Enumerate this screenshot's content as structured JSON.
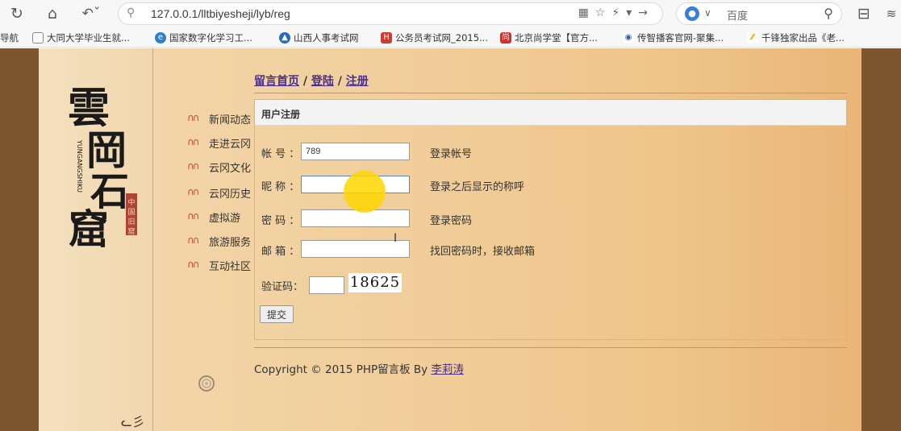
{
  "browser": {
    "url": "127.0.0.1/lltbiyesheji/lyb/reg",
    "search_engine": "百度"
  },
  "bookmarks": [
    {
      "label": "导航",
      "icon": "none"
    },
    {
      "label": "大同大学毕业生就...",
      "icon": "page-icon"
    },
    {
      "label": "国家数字化学习工...",
      "icon": "e-icon"
    },
    {
      "label": "山西人事考试网",
      "icon": "blue-logo-icon"
    },
    {
      "label": "公务员考试网_2015...",
      "icon": "red-logo-icon"
    },
    {
      "label": "北京尚学堂【官方...",
      "icon": "shang-icon"
    },
    {
      "label": "传智播客官网-聚集...",
      "icon": "blue-swirl-icon"
    },
    {
      "label": "千锋独家出品《老...",
      "icon": "yellow-bars-icon"
    }
  ],
  "site": {
    "logo_text": "雲岡石窟",
    "logo_latin": "YUNGANGSHIKU",
    "logo_seal": "中国旧窟"
  },
  "nav": [
    "新闻动态",
    "走进云冈",
    "云冈文化",
    "云冈历史",
    "虚拟游",
    "旅游服务",
    "互动社区"
  ],
  "breadcrumb": {
    "home": "留言首页",
    "sep1": " / ",
    "login": "登陆",
    "sep2": " / ",
    "register": "注册"
  },
  "form": {
    "title": "用户注册",
    "account_label": "帐 号 ：",
    "account_value": "789",
    "account_hint": "登录帐号",
    "nickname_label": "昵 称 ：",
    "nickname_value": "",
    "nickname_hint": "登录之后显示的称呼",
    "password_label": "密 码 ：",
    "password_hint": "登录密码",
    "email_label": "邮 箱 ：",
    "email_hint": "找回密码时，接收邮箱",
    "captcha_label": "验证码：",
    "captcha_code": "18625",
    "submit_label": "提交"
  },
  "footer": {
    "text": "Copyright © 2015 PHP留言板 By ",
    "author": "李莉涛"
  },
  "colors": {
    "page_bg": "#7d5630",
    "link": "#4a2f86",
    "cursor_highlight": "#ffd600"
  }
}
